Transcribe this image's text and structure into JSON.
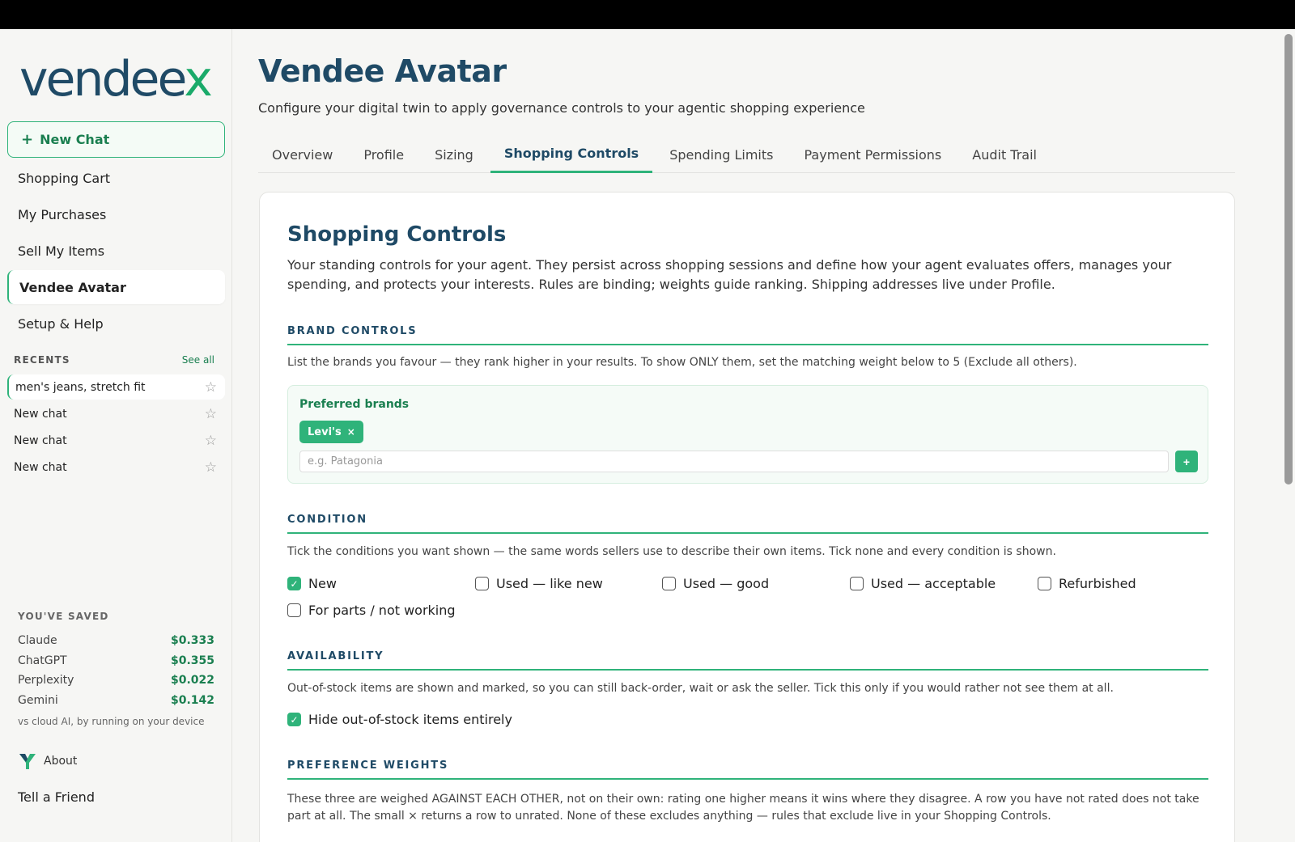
{
  "sidebar": {
    "logo_text_main": "vendee",
    "logo_text_x": "x",
    "new_chat_label": "New Chat",
    "nav": [
      {
        "label": "Shopping Cart"
      },
      {
        "label": "My Purchases"
      },
      {
        "label": "Sell My Items"
      },
      {
        "label": "Vendee Avatar",
        "active": true
      },
      {
        "label": "Setup & Help"
      }
    ],
    "recents_title": "RECENTS",
    "see_all": "See all",
    "recents": [
      {
        "label": "men's jeans, stretch fit",
        "active": true
      },
      {
        "label": "New chat"
      },
      {
        "label": "New chat"
      },
      {
        "label": "New chat"
      }
    ],
    "saved_title": "YOU'VE SAVED",
    "saved": [
      {
        "name": "Claude",
        "amount": "$0.333"
      },
      {
        "name": "ChatGPT",
        "amount": "$0.355"
      },
      {
        "name": "Perplexity",
        "amount": "$0.022"
      },
      {
        "name": "Gemini",
        "amount": "$0.142"
      }
    ],
    "saved_note": "vs cloud AI, by running on your device",
    "about_label": "About",
    "tell_label": "Tell a Friend"
  },
  "main": {
    "title": "Vendee Avatar",
    "subtitle": "Configure your digital twin to apply governance controls to your agentic shopping experience",
    "tabs": [
      {
        "label": "Overview"
      },
      {
        "label": "Profile"
      },
      {
        "label": "Sizing"
      },
      {
        "label": "Shopping Controls",
        "active": true
      },
      {
        "label": "Spending Limits"
      },
      {
        "label": "Payment Permissions"
      },
      {
        "label": "Audit Trail"
      }
    ]
  },
  "card": {
    "title": "Shopping Controls",
    "description": "Your standing controls for your agent. They persist across shopping sessions and define how your agent evaluates offers, manages your spending, and protects your interests. Rules are binding; weights guide ranking. Shipping addresses live under Profile.",
    "brand": {
      "heading": "BRAND CONTROLS",
      "note": "List the brands you favour — they rank higher in your results. To show ONLY them, set the matching weight below to 5 (Exclude all others).",
      "label": "Preferred brands",
      "chips": [
        {
          "label": "Levi's",
          "remove": "×"
        }
      ],
      "input_value": "",
      "input_placeholder": "e.g. Patagonia",
      "add_label": "+"
    },
    "condition": {
      "heading": "CONDITION",
      "note": "Tick the conditions you want shown — the same words sellers use to describe their own items. Tick none and every condition is shown.",
      "options": [
        {
          "label": "New",
          "checked": true
        },
        {
          "label": "Used — like new",
          "checked": false
        },
        {
          "label": "Used — good",
          "checked": false
        },
        {
          "label": "Used — acceptable",
          "checked": false
        },
        {
          "label": "Refurbished",
          "checked": false
        },
        {
          "label": "For parts / not working",
          "checked": false
        }
      ]
    },
    "availability": {
      "heading": "AVAILABILITY",
      "note": "Out-of-stock items are shown and marked, so you can still back-order, wait or ask the seller. Tick this only if you would rather not see them at all.",
      "option": {
        "label": "Hide out-of-stock items entirely",
        "checked": true
      }
    },
    "weights": {
      "heading": "PREFERENCE WEIGHTS",
      "note": "These three are weighed AGAINST EACH OTHER, not on their own: rating one higher means it wins where they disagree. A row you have not rated does not take part at all. The small × returns a row to unrated. None of these excludes anything — rules that exclude live in your Shopping Controls."
    }
  },
  "colors": {
    "brand_navy": "#1f4a66",
    "accent_green": "#2fb37a",
    "savings_green": "#1a7f50"
  }
}
